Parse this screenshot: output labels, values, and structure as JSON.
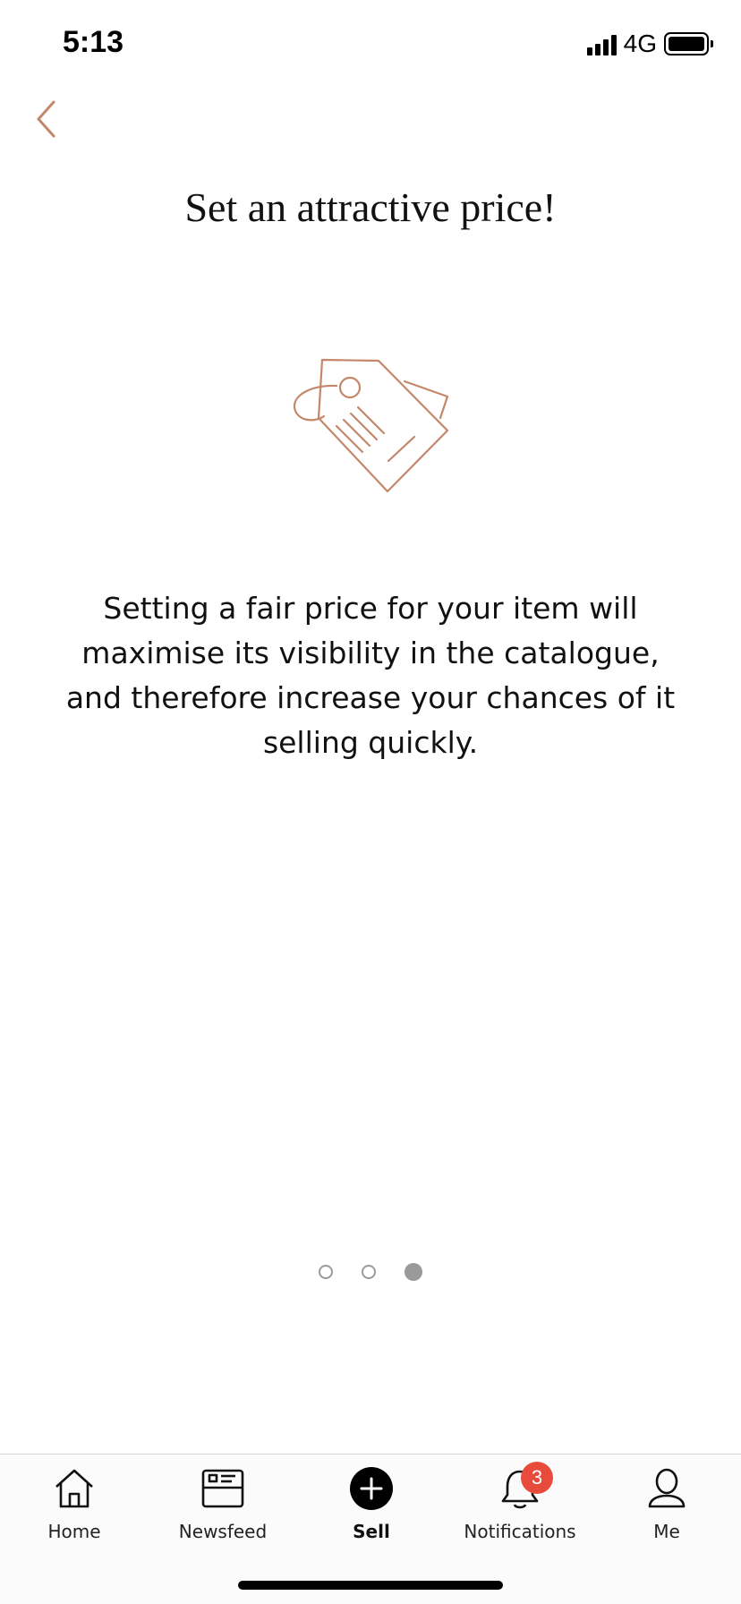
{
  "status_bar": {
    "time": "5:13",
    "network": "4G"
  },
  "header": {
    "back_icon": "chevron-left-icon",
    "title": "Set an attractive price!"
  },
  "illustration": {
    "icon": "price-tag-icon",
    "color": "#c4876a"
  },
  "body": {
    "description": "Setting a fair price for your item will maximise its visibility in the catalogue, and therefore increase your chances of it selling quickly."
  },
  "pager": {
    "total_pages": 3,
    "current_page": 3
  },
  "tab_bar": {
    "tabs": [
      {
        "label": "Home",
        "icon": "home-icon"
      },
      {
        "label": "Newsfeed",
        "icon": "newsfeed-icon"
      },
      {
        "label": "Sell",
        "icon": "plus-circle-icon",
        "active": true
      },
      {
        "label": "Notifications",
        "icon": "bell-icon",
        "badge": "3"
      },
      {
        "label": "Me",
        "icon": "person-icon"
      }
    ]
  },
  "colors": {
    "accent": "#c4876a",
    "badge": "#e84b3c"
  }
}
